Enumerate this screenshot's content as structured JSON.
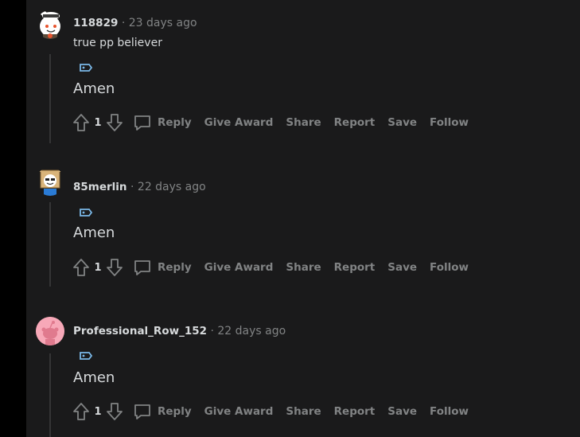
{
  "comments": [
    {
      "author": "118829",
      "separator": "·",
      "time": "23 days ago",
      "first_line": "true pp believer",
      "body": "Amen",
      "score": "1",
      "actions": {
        "reply": "Reply",
        "give_award": "Give Award",
        "share": "Share",
        "report": "Report",
        "save": "Save",
        "follow": "Follow"
      },
      "avatar_icon": "snoo-avatar-chef-icon"
    },
    {
      "author": "85merlin",
      "separator": "·",
      "time": "22 days ago",
      "body": "Amen",
      "score": "1",
      "actions": {
        "reply": "Reply",
        "give_award": "Give Award",
        "share": "Share",
        "report": "Report",
        "save": "Save",
        "follow": "Follow"
      },
      "avatar_icon": "snoo-avatar-box-head-icon"
    },
    {
      "author": "Professional_Row_152",
      "separator": "·",
      "time": "22 days ago",
      "body": "Amen",
      "score": "1",
      "actions": {
        "reply": "Reply",
        "give_award": "Give Award",
        "share": "Share",
        "report": "Report",
        "save": "Save",
        "follow": "Follow"
      },
      "avatar_icon": "default-snoo-avatar-icon"
    }
  ],
  "colors": {
    "background": "#1a1a1b",
    "gutter": "#000000",
    "text_primary": "#d7dadc",
    "text_muted": "#818384",
    "flair_blue": "#7ab8e8",
    "avatar_pink": "#f7a8b8"
  }
}
